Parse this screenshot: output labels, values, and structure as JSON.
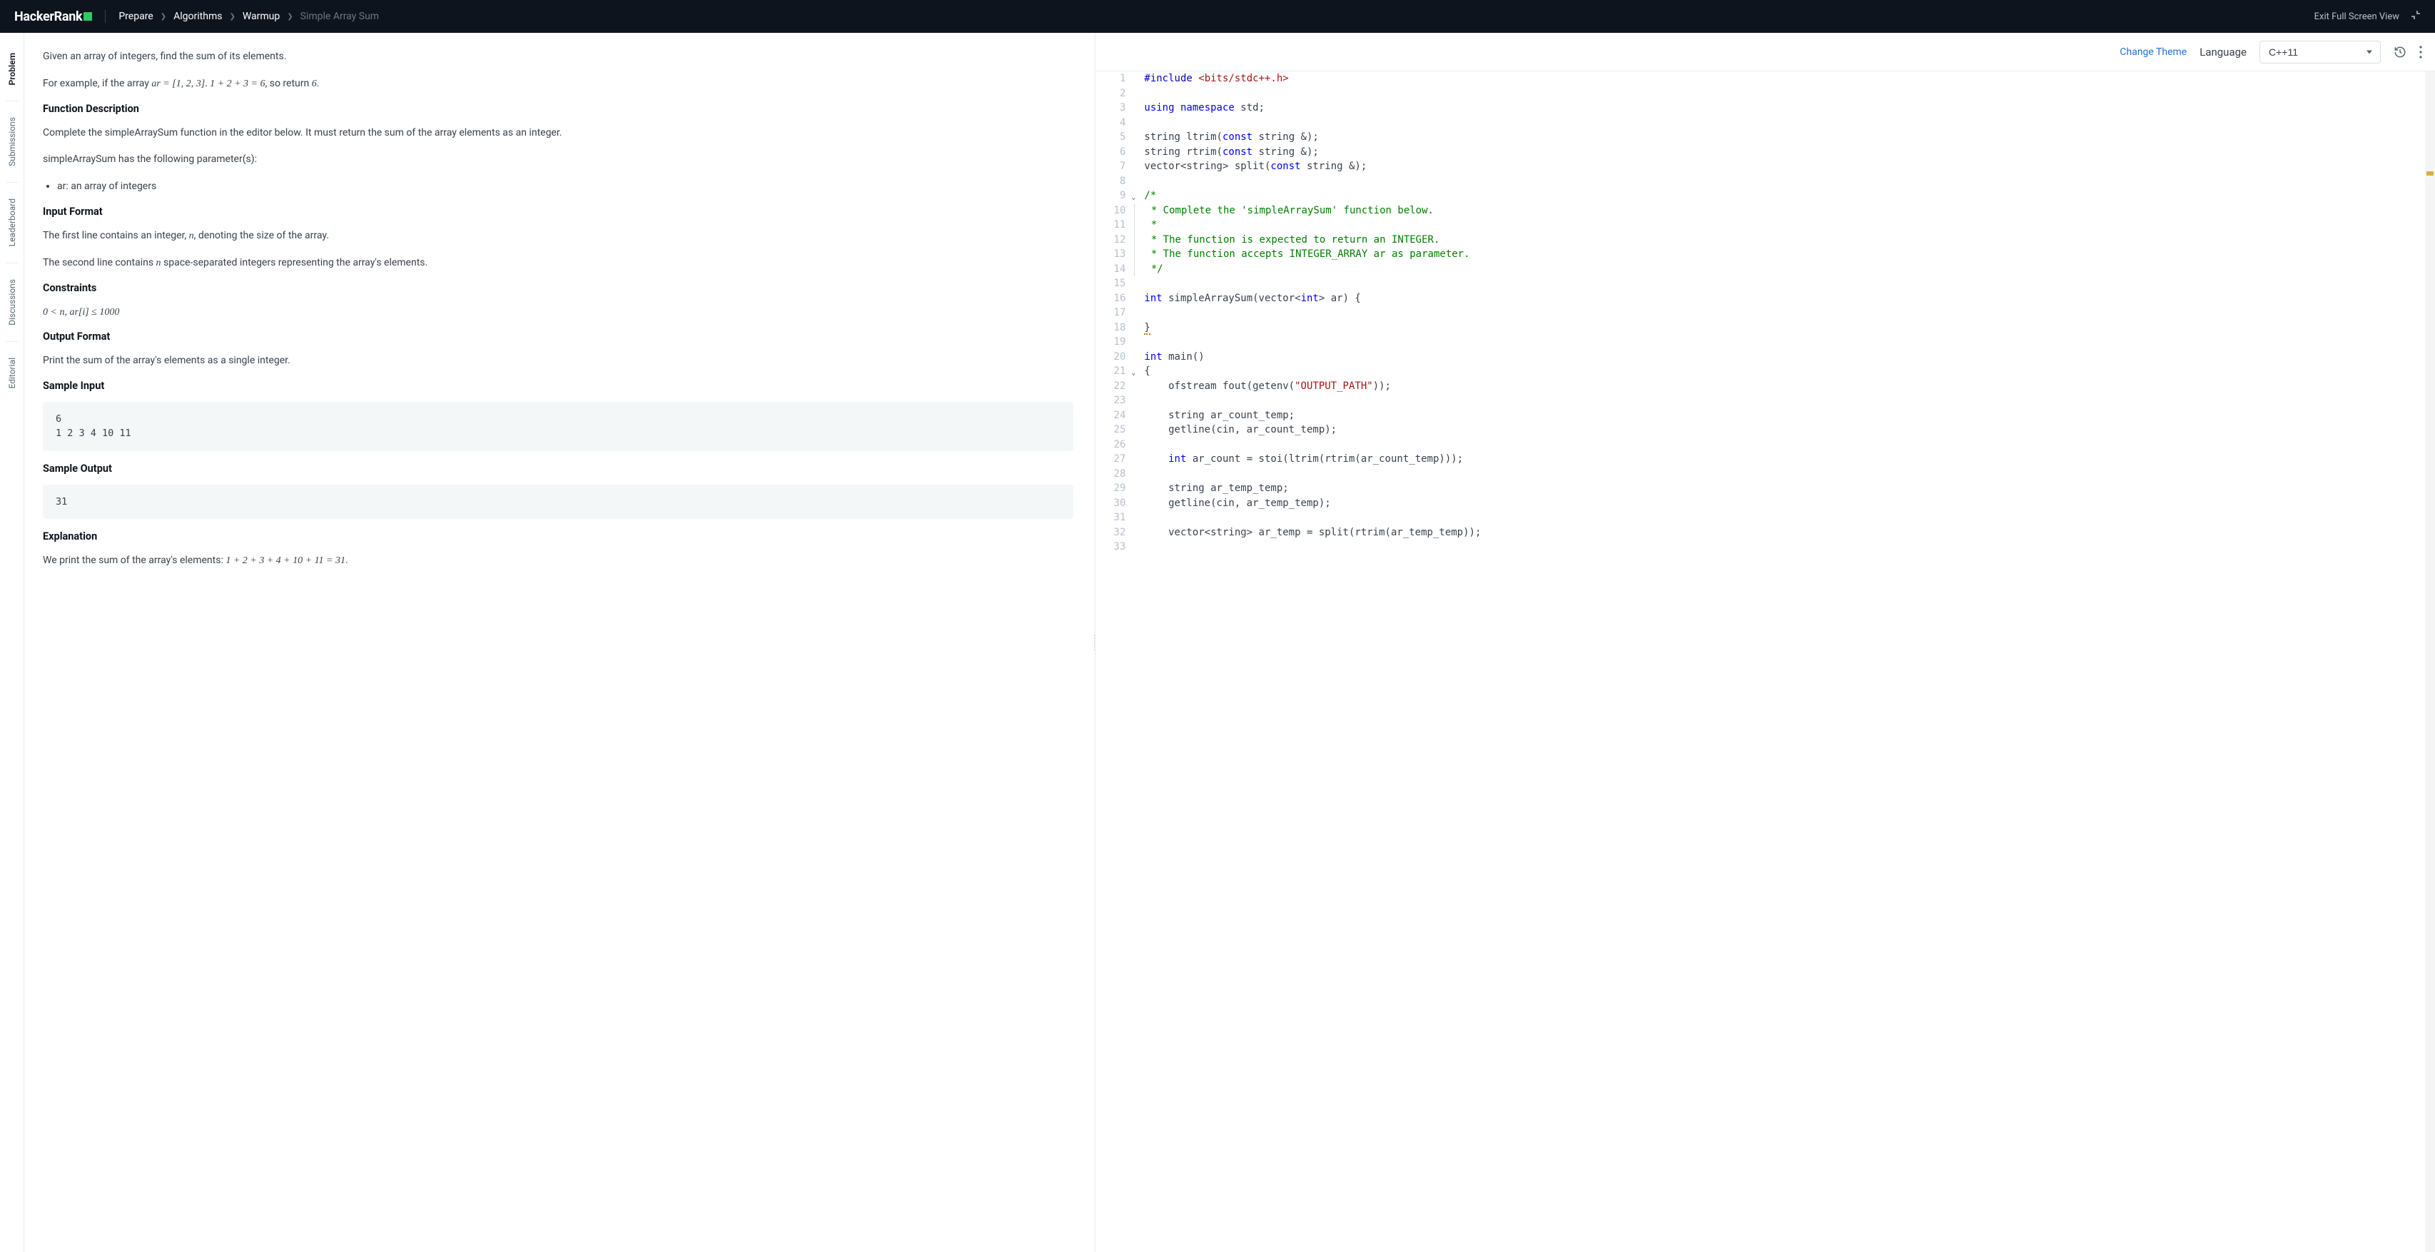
{
  "header": {
    "logo_text": "HackerRank",
    "breadcrumb": [
      "Prepare",
      "Algorithms",
      "Warmup"
    ],
    "current_page": "Simple Array Sum",
    "exit_label": "Exit Full Screen View"
  },
  "side_tabs": [
    {
      "label": "Problem",
      "active": true
    },
    {
      "label": "Submissions",
      "active": false
    },
    {
      "label": "Leaderboard",
      "active": false
    },
    {
      "label": "Discussions",
      "active": false
    },
    {
      "label": "Editorial",
      "active": false
    }
  ],
  "problem": {
    "intro": "Given an array of integers, find the sum of its elements.",
    "example_prefix": "For example, if the array ",
    "example_ar": "ar = [1, 2, 3]",
    "example_sum": "1 + 2 + 3 = 6",
    "example_suffix": ", so return ",
    "example_return": "6",
    "fn_desc_head": "Function Description",
    "fn_desc_body": "Complete the simpleArraySum function in the editor below. It must return the sum of the array elements as an integer.",
    "params_intro": "simpleArraySum has the following parameter(s):",
    "params": [
      "ar: an array of integers"
    ],
    "input_head": "Input Format",
    "input_l1_a": "The first line contains an integer, ",
    "input_l1_var": "n",
    "input_l1_b": ", denoting the size of the array.",
    "input_l2_a": "The second line contains ",
    "input_l2_var": "n",
    "input_l2_b": " space-separated integers representing the array's elements.",
    "constraints_head": "Constraints",
    "constraints_expr": "0 < n, ar[i] ≤ 1000",
    "output_head": "Output Format",
    "output_body": "Print the sum of the array's elements as a single integer.",
    "sample_input_head": "Sample Input",
    "sample_input": "6\n1 2 3 4 10 11",
    "sample_output_head": "Sample Output",
    "sample_output": "31",
    "explanation_head": "Explanation",
    "explanation_a": "We print the sum of the array's elements: ",
    "explanation_math": "1 + 2 + 3 + 4 + 10 + 11 = 31",
    "explanation_b": "."
  },
  "editor_bar": {
    "change_theme": "Change Theme",
    "language_label": "Language",
    "language_value": "C++11"
  },
  "code": {
    "lines": [
      {
        "n": 1,
        "html": "<span class='tok-pp'>#include</span> <span class='tok-inc'>&lt;bits/stdc++.h&gt;</span>"
      },
      {
        "n": 2,
        "html": ""
      },
      {
        "n": 3,
        "html": "<span class='tok-kw'>using</span> <span class='tok-kw'>namespace</span> std;"
      },
      {
        "n": 4,
        "html": ""
      },
      {
        "n": 5,
        "html": "string ltrim(<span class='tok-kw'>const</span> string &amp;);"
      },
      {
        "n": 6,
        "html": "string rtrim(<span class='tok-kw'>const</span> string &amp;);"
      },
      {
        "n": 7,
        "html": "vector&lt;string&gt; split(<span class='tok-kw'>const</span> string &amp;);"
      },
      {
        "n": 8,
        "html": ""
      },
      {
        "n": 9,
        "html": "<span class='tok-cmt'>/*</span>",
        "fold": true
      },
      {
        "n": 10,
        "html": "<span class='tok-cmt'> * Complete the 'simpleArraySum' function below.</span>",
        "cmt": true
      },
      {
        "n": 11,
        "html": "<span class='tok-cmt'> *</span>",
        "cmt": true
      },
      {
        "n": 12,
        "html": "<span class='tok-cmt'> * The function is expected to return an INTEGER.</span>",
        "cmt": true
      },
      {
        "n": 13,
        "html": "<span class='tok-cmt'> * The function accepts INTEGER_ARRAY ar as parameter.</span>",
        "cmt": true
      },
      {
        "n": 14,
        "html": "<span class='tok-cmt'> */</span>",
        "cmt": true
      },
      {
        "n": 15,
        "html": ""
      },
      {
        "n": 16,
        "html": "<span class='tok-type'>int</span> simpleArraySum(vector&lt;<span class='tok-type'>int</span>&gt; ar) {"
      },
      {
        "n": 17,
        "html": ""
      },
      {
        "n": 18,
        "html": "<span class='erl'>}</span>"
      },
      {
        "n": 19,
        "html": ""
      },
      {
        "n": 20,
        "html": "<span class='tok-type'>int</span> main()"
      },
      {
        "n": 21,
        "html": "{",
        "fold": true
      },
      {
        "n": 22,
        "html": "    ofstream fout(getenv(<span class='tok-str'>\"OUTPUT_PATH\"</span>));"
      },
      {
        "n": 23,
        "html": ""
      },
      {
        "n": 24,
        "html": "    string ar_count_temp;"
      },
      {
        "n": 25,
        "html": "    getline(cin, ar_count_temp);"
      },
      {
        "n": 26,
        "html": ""
      },
      {
        "n": 27,
        "html": "    <span class='tok-type'>int</span> ar_count = stoi(ltrim(rtrim(ar_count_temp)));"
      },
      {
        "n": 28,
        "html": ""
      },
      {
        "n": 29,
        "html": "    string ar_temp_temp;"
      },
      {
        "n": 30,
        "html": "    getline(cin, ar_temp_temp);"
      },
      {
        "n": 31,
        "html": ""
      },
      {
        "n": 32,
        "html": "    vector&lt;string&gt; ar_temp = split(rtrim(ar_temp_temp));"
      },
      {
        "n": 33,
        "html": ""
      }
    ]
  }
}
